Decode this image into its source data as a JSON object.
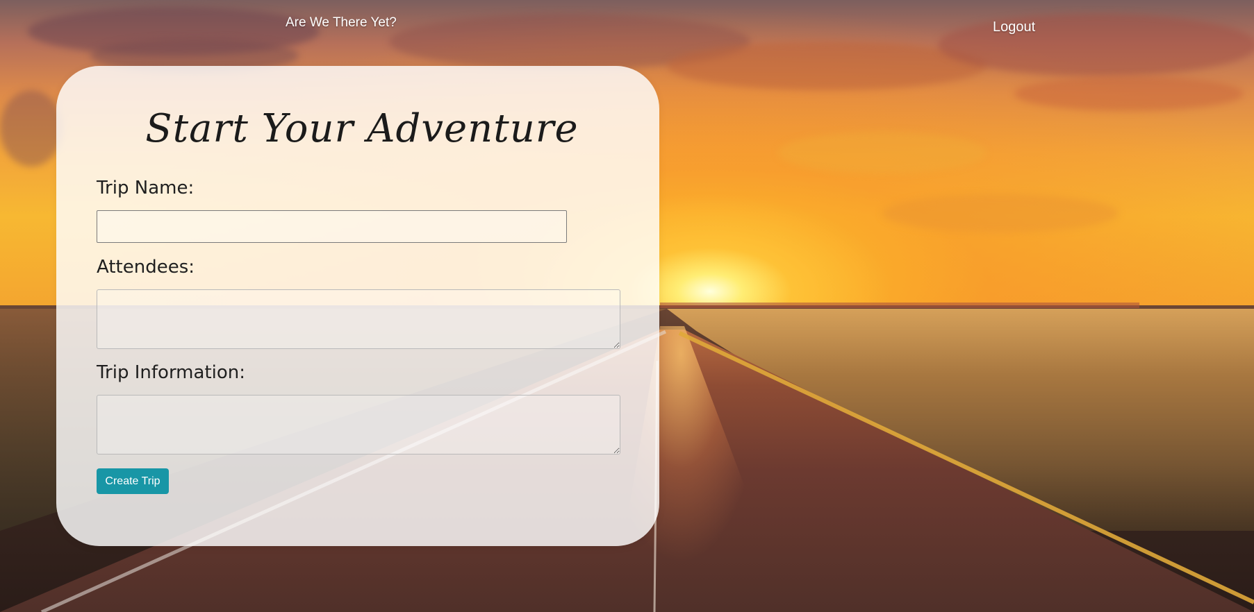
{
  "nav": {
    "title": "Are We There Yet?",
    "logout_label": "Logout"
  },
  "form": {
    "heading": "Start Your Adventure",
    "trip_name": {
      "label": "Trip Name:",
      "value": "",
      "placeholder": ""
    },
    "attendees": {
      "label": "Attendees:",
      "value": "",
      "placeholder": ""
    },
    "trip_information": {
      "label": "Trip Information:",
      "value": "",
      "placeholder": ""
    },
    "submit_label": "Create Trip"
  },
  "colors": {
    "button": "#1896a6",
    "card_background": "rgba(255,255,255,0.82)",
    "nav_text": "#ffffff"
  }
}
